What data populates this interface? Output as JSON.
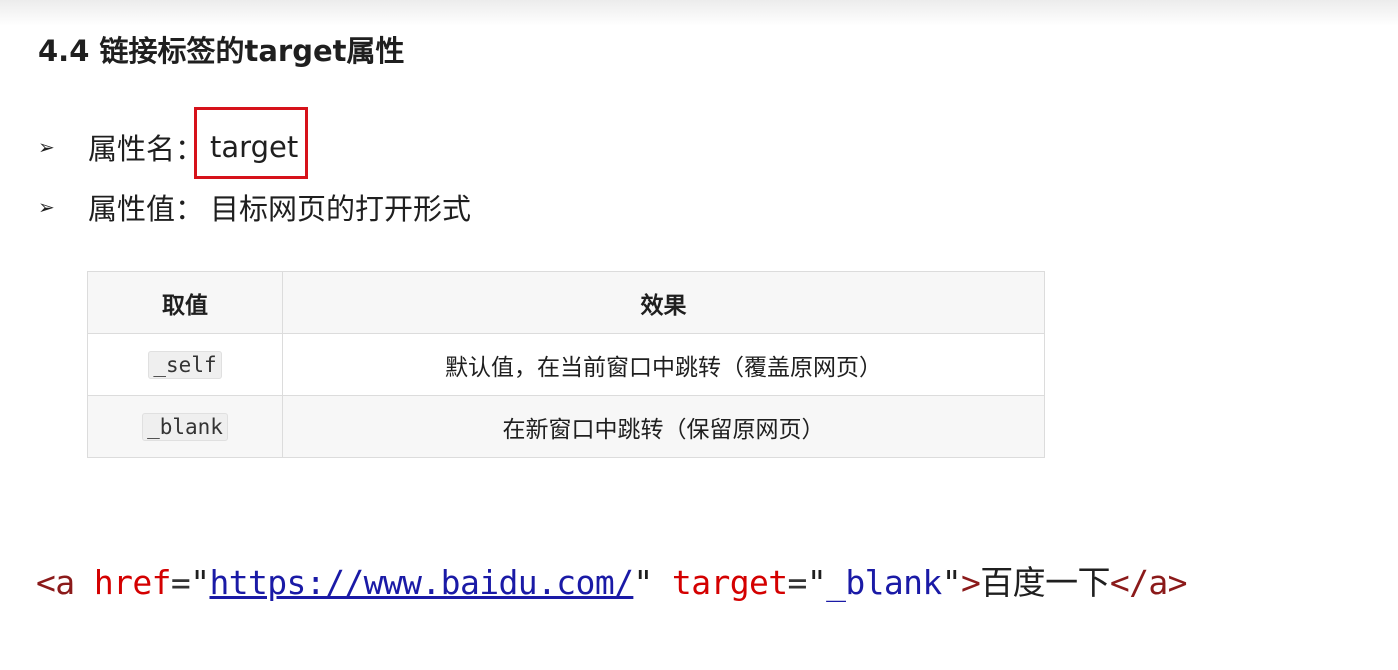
{
  "heading": "4.4 链接标签的target属性",
  "bullets": [
    {
      "label": "属性名：",
      "value": "target"
    },
    {
      "label": "属性值：",
      "value": "目标网页的打开形式"
    }
  ],
  "arrow_glyph": "➢",
  "table": {
    "headers": [
      "取值",
      "效果"
    ],
    "rows": [
      {
        "value": "_self",
        "effect": "默认值，在当前窗口中跳转（覆盖原网页）"
      },
      {
        "value": "_blank",
        "effect": "在新窗口中跳转（保留原网页）"
      }
    ]
  },
  "code": {
    "open_tag": "<a",
    "attr1": "href",
    "eq": "=",
    "quote": "\"",
    "url": "https://www.baidu.com/",
    "attr2": "target",
    "target_value": "_blank",
    "close_bracket": ">",
    "link_text": "百度一下",
    "end_tag": "</a>"
  },
  "colors": {
    "highlight_border": "#d6121a",
    "tag": "#8b1a1a",
    "attribute": "#d40000",
    "string": "#1a1aa6"
  }
}
